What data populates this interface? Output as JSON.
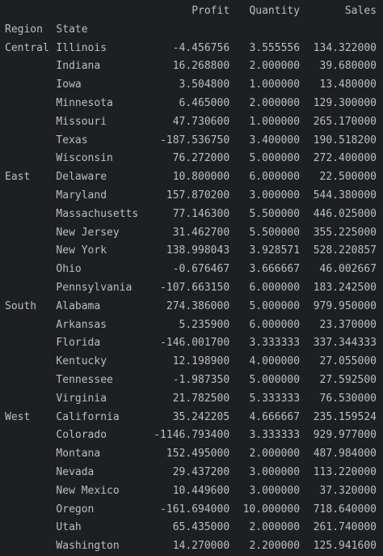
{
  "columns": {
    "index_region": "Region",
    "index_state": "State",
    "profit": "Profit",
    "quantity": "Quantity",
    "sales": "Sales"
  },
  "rows": [
    {
      "region": "Central",
      "state": "Illinois",
      "profit": "-4.456756",
      "quantity": "3.555556",
      "sales": "134.322000"
    },
    {
      "region": "",
      "state": "Indiana",
      "profit": "16.268800",
      "quantity": "2.000000",
      "sales": "39.680000"
    },
    {
      "region": "",
      "state": "Iowa",
      "profit": "3.504800",
      "quantity": "1.000000",
      "sales": "13.480000"
    },
    {
      "region": "",
      "state": "Minnesota",
      "profit": "6.465000",
      "quantity": "2.000000",
      "sales": "129.300000"
    },
    {
      "region": "",
      "state": "Missouri",
      "profit": "47.730600",
      "quantity": "1.000000",
      "sales": "265.170000"
    },
    {
      "region": "",
      "state": "Texas",
      "profit": "-187.536750",
      "quantity": "3.400000",
      "sales": "190.518200"
    },
    {
      "region": "",
      "state": "Wisconsin",
      "profit": "76.272000",
      "quantity": "5.000000",
      "sales": "272.400000"
    },
    {
      "region": "East",
      "state": "Delaware",
      "profit": "10.800000",
      "quantity": "6.000000",
      "sales": "22.500000"
    },
    {
      "region": "",
      "state": "Maryland",
      "profit": "157.870200",
      "quantity": "3.000000",
      "sales": "544.380000"
    },
    {
      "region": "",
      "state": "Massachusetts",
      "profit": "77.146300",
      "quantity": "5.500000",
      "sales": "446.025000"
    },
    {
      "region": "",
      "state": "New Jersey",
      "profit": "31.462700",
      "quantity": "5.500000",
      "sales": "355.225000"
    },
    {
      "region": "",
      "state": "New York",
      "profit": "138.998043",
      "quantity": "3.928571",
      "sales": "528.220857"
    },
    {
      "region": "",
      "state": "Ohio",
      "profit": "-0.676467",
      "quantity": "3.666667",
      "sales": "46.002667"
    },
    {
      "region": "",
      "state": "Pennsylvania",
      "profit": "-107.663150",
      "quantity": "6.000000",
      "sales": "183.242500"
    },
    {
      "region": "South",
      "state": "Alabama",
      "profit": "274.386000",
      "quantity": "5.000000",
      "sales": "979.950000"
    },
    {
      "region": "",
      "state": "Arkansas",
      "profit": "5.235900",
      "quantity": "6.000000",
      "sales": "23.370000"
    },
    {
      "region": "",
      "state": "Florida",
      "profit": "-146.001700",
      "quantity": "3.333333",
      "sales": "337.344333"
    },
    {
      "region": "",
      "state": "Kentucky",
      "profit": "12.198900",
      "quantity": "4.000000",
      "sales": "27.055000"
    },
    {
      "region": "",
      "state": "Tennessee",
      "profit": "-1.987350",
      "quantity": "5.000000",
      "sales": "27.592500"
    },
    {
      "region": "",
      "state": "Virginia",
      "profit": "21.782500",
      "quantity": "5.333333",
      "sales": "76.530000"
    },
    {
      "region": "West",
      "state": "California",
      "profit": "35.242205",
      "quantity": "4.666667",
      "sales": "235.159524"
    },
    {
      "region": "",
      "state": "Colorado",
      "profit": "-1146.793400",
      "quantity": "3.333333",
      "sales": "929.977000"
    },
    {
      "region": "",
      "state": "Montana",
      "profit": "152.495000",
      "quantity": "2.000000",
      "sales": "487.984000"
    },
    {
      "region": "",
      "state": "Nevada",
      "profit": "29.437200",
      "quantity": "3.000000",
      "sales": "113.220000"
    },
    {
      "region": "",
      "state": "New Mexico",
      "profit": "10.449600",
      "quantity": "3.000000",
      "sales": "37.320000"
    },
    {
      "region": "",
      "state": "Oregon",
      "profit": "-161.694000",
      "quantity": "10.000000",
      "sales": "718.640000"
    },
    {
      "region": "",
      "state": "Utah",
      "profit": "65.435000",
      "quantity": "2.000000",
      "sales": "261.740000"
    },
    {
      "region": "",
      "state": "Washington",
      "profit": "14.270000",
      "quantity": "2.200000",
      "sales": "125.941600"
    }
  ]
}
